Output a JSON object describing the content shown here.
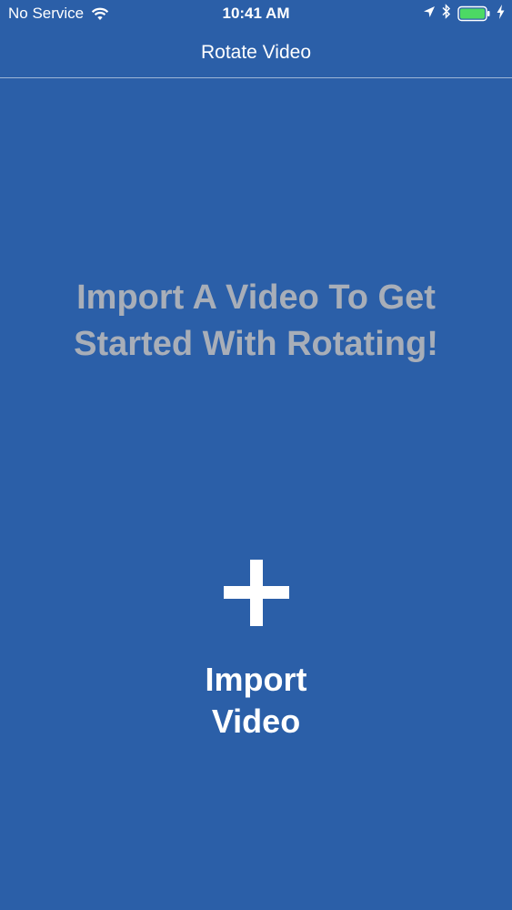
{
  "status_bar": {
    "carrier": "No Service",
    "time": "10:41 AM",
    "icons": [
      "wifi-icon",
      "location-arrow-icon",
      "bluetooth-icon",
      "battery-icon",
      "charging-bolt-icon"
    ],
    "battery_color": "#4cd964"
  },
  "nav": {
    "title": "Rotate Video"
  },
  "main": {
    "empty_message_line1": "Import A Video To Get",
    "empty_message_line2": "Started With Rotating!",
    "import_button": {
      "icon": "plus-icon",
      "label_line1": "Import",
      "label_line2": "Video"
    }
  },
  "colors": {
    "background": "#2b5fa8",
    "message_text": "#a8aeb8",
    "text": "#ffffff"
  }
}
